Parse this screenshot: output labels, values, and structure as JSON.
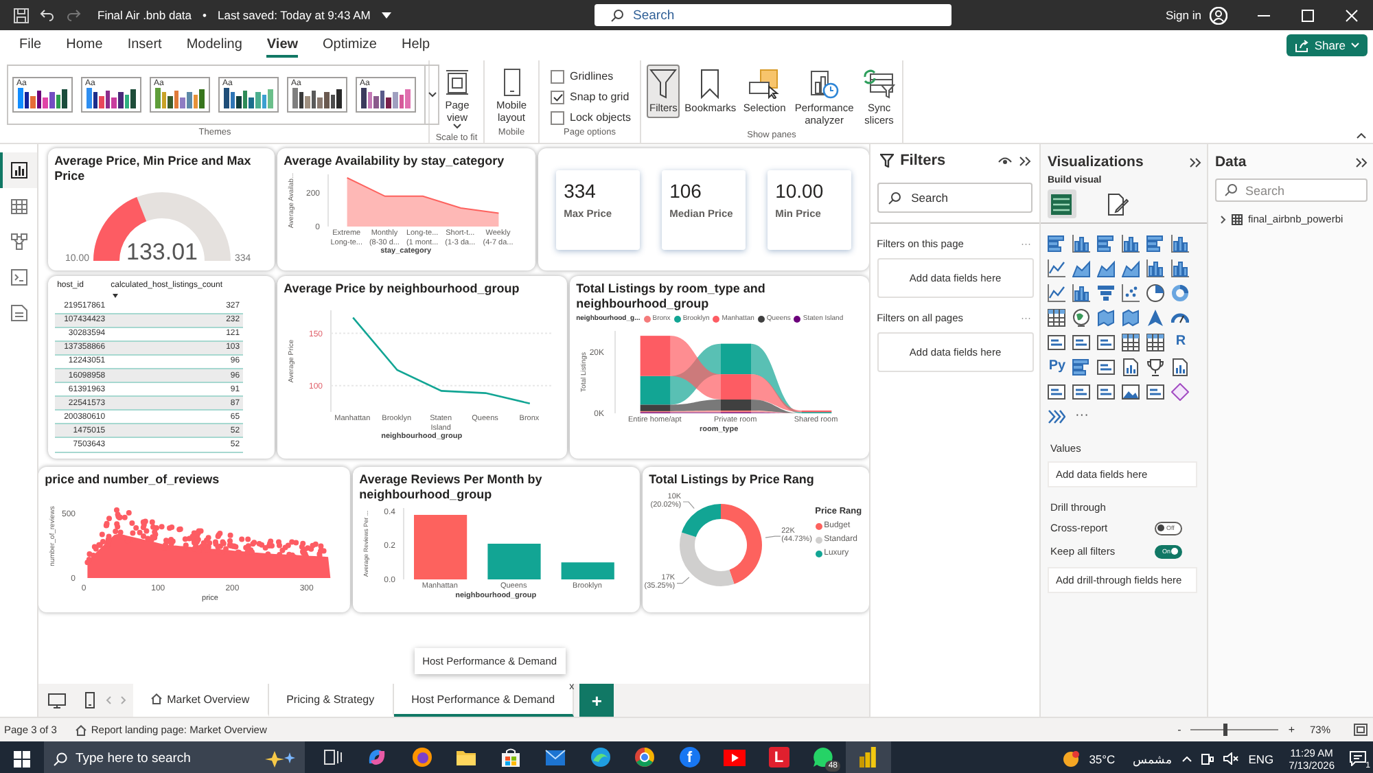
{
  "title_bar": {
    "title": "Final Air .bnb data",
    "separator": "•",
    "saved": "Last saved: Today at 9:43 AM",
    "search": {
      "placeholder": "Search"
    },
    "sign_in": "Sign in"
  },
  "menu": [
    {
      "label": "File",
      "selected": false
    },
    {
      "label": "Home",
      "selected": false
    },
    {
      "label": "Insert",
      "selected": false
    },
    {
      "label": "Modeling",
      "selected": false
    },
    {
      "label": "View",
      "selected": true
    },
    {
      "label": "Optimize",
      "selected": false
    },
    {
      "label": "Help",
      "selected": false
    }
  ],
  "share": {
    "label": "Share"
  },
  "ribbon": {
    "themes": {
      "group": "Themes",
      "items": [
        {
          "label": "Aa"
        },
        {
          "label": "Aa"
        },
        {
          "label": "Aa"
        },
        {
          "label": "Aa"
        },
        {
          "label": "Aa"
        },
        {
          "label": "Aa"
        }
      ]
    },
    "page_view": {
      "label": "Page view",
      "group": "Scale to fit"
    },
    "mobile": {
      "label": "Mobile layout",
      "group": "Mobile"
    },
    "page_options": {
      "group": "Page options",
      "items": [
        {
          "label": "Gridlines",
          "checked": false
        },
        {
          "label": "Snap to grid",
          "checked": true
        },
        {
          "label": "Lock objects",
          "checked": false
        }
      ]
    },
    "show_panes": {
      "group": "Show panes",
      "items": [
        {
          "kind": "filter",
          "label": "Filters",
          "selected": true
        },
        {
          "kind": "bookmark",
          "label": "Bookmarks",
          "selected": false
        },
        {
          "kind": "selection",
          "label": "Selection",
          "selected": false
        },
        {
          "kind": "performance",
          "label": "Performance analyzer",
          "selected": false
        },
        {
          "kind": "sync",
          "label": "Sync slicers",
          "selected": false
        }
      ]
    }
  },
  "views": [
    {
      "kind": "report",
      "selected": true
    },
    {
      "kind": "table",
      "selected": false
    },
    {
      "kind": "model",
      "selected": false
    },
    {
      "kind": "query",
      "selected": false
    },
    {
      "kind": "script",
      "selected": false
    }
  ],
  "report": {
    "gauge": {
      "title": "Average Price, Min Price and Max Price",
      "value": "133.01",
      "min": "10.00",
      "max": "334",
      "level": 0.38
    },
    "availability": {
      "title": "Average Availability by stay_category",
      "chart_data": {
        "type": "area",
        "xlabel": "stay_category",
        "ylabel": "Average Availab...",
        "categories": [
          "Extreme Long-te...",
          "Monthly (8-30 d...",
          "Long-te... (1 mont...",
          "Short-t... (1-3 da...",
          "Weekly (4-7 da..."
        ],
        "ylim": [
          0,
          310
        ],
        "yticks": [
          {
            "value": 0,
            "label": "0"
          },
          {
            "value": 200,
            "label": "200"
          }
        ],
        "series": [
          {
            "color": "#fd625e",
            "values": [
              290,
              180,
              180,
              110,
              80
            ]
          }
        ]
      }
    },
    "cards": [
      {
        "value": "334",
        "label": "Max Price"
      },
      {
        "value": "106",
        "label": "Median Price"
      },
      {
        "value": "10.00",
        "label": "Min Price"
      }
    ],
    "hosts": {
      "columns": [
        "host_id",
        "calculated_host_listings_count"
      ],
      "rows": [
        [
          "219517861",
          "327"
        ],
        [
          "107434423",
          "232"
        ],
        [
          "30283594",
          "121"
        ],
        [
          "137358866",
          "103"
        ],
        [
          "12243051",
          "96"
        ],
        [
          "16098958",
          "96"
        ],
        [
          "61391963",
          "91"
        ],
        [
          "22541573",
          "87"
        ],
        [
          "200380610",
          "65"
        ],
        [
          "1475015",
          "52"
        ],
        [
          "7503643",
          "52"
        ]
      ]
    },
    "price_line": {
      "title": "Average Price by neighbourhood_group",
      "chart_data": {
        "type": "line",
        "xlabel": "neighbourhood_group",
        "ylabel": "Average Price",
        "categories": [
          "Manhattan",
          "Brooklyn",
          "Staten Island",
          "Queens",
          "Bronx"
        ],
        "ylim": [
          75,
          172
        ],
        "yticks": [
          {
            "value": 100,
            "label": "100"
          },
          {
            "value": 150,
            "label": "150"
          }
        ],
        "series": [
          {
            "color": "#12a594",
            "values": [
              165,
              115,
              95,
              93,
              83
            ]
          }
        ]
      }
    },
    "listings_ribbon": {
      "title": "Total Listings by room_type and neighbourhood_group",
      "legend_title": "neighbourhood_g...",
      "chart_data": {
        "type": "bar",
        "stacked": true,
        "xlabel": "room_type",
        "ylabel": "Total Listings",
        "categories": [
          "Entire home/apt",
          "Private room",
          "Shared room"
        ],
        "ylim": [
          0,
          27000
        ],
        "yticks": [
          {
            "value": 0,
            "label": "0K"
          },
          {
            "value": 20000,
            "label": "20K"
          }
        ],
        "series": [
          {
            "name": "Bronx",
            "color": "#f47b7b",
            "values": [
              400,
              600,
              0
            ]
          },
          {
            "name": "Brooklyn",
            "color": "#12a594",
            "values": [
              9400,
              10000,
              400
            ]
          },
          {
            "name": "Manhattan",
            "color": "#fd5c63",
            "values": [
              13200,
              8300,
              500
            ]
          },
          {
            "name": "Queens",
            "color": "#404040",
            "values": [
              2100,
              3600,
              0
            ]
          },
          {
            "name": "Staten Island",
            "color": "#6b007b",
            "values": [
              300,
              300,
              0
            ]
          }
        ]
      }
    },
    "scatter": {
      "title": "price and number_of_reviews",
      "xlabel": "price",
      "ylabel": "number_of_reviews",
      "xticks": [
        "0",
        "100",
        "200",
        "300"
      ],
      "yticks": [
        "500",
        "0"
      ]
    },
    "reviews_bar": {
      "title": "Average Reviews Per Month by neighbourhood_group",
      "chart_data": {
        "type": "bar",
        "xlabel": "neighbourhood_group",
        "ylabel": "Average Reviews Per ...",
        "categories": [
          "Manhattan",
          "Queens",
          "Brooklyn"
        ],
        "ylim": [
          0,
          0.42
        ],
        "yticks": [
          {
            "value": 0,
            "label": "0.0"
          },
          {
            "value": 0.2,
            "label": "0.2"
          },
          {
            "value": 0.4,
            "label": "0.4"
          }
        ],
        "series": [
          {
            "colors": [
              "#fd625e",
              "#12a594",
              "#12a594"
            ],
            "values": [
              0.38,
              0.21,
              0.1
            ]
          }
        ]
      }
    },
    "price_range": {
      "title": "Total Listings by Price Rang",
      "legend_title": "Price Rang",
      "chart_data": {
        "type": "donut",
        "categories": [
          "Budget",
          "Standard",
          "Luxury"
        ],
        "values": [
          44.73,
          35.25,
          20.02
        ],
        "colors": [
          "#fd625e",
          "#d0cfce",
          "#12a594"
        ],
        "value_labels": [
          "22K (44.73%)",
          "17K (35.25%)",
          "10K (20.02%)"
        ]
      }
    }
  },
  "filters_pane": {
    "title": "Filters",
    "search": {
      "placeholder": "Search"
    },
    "sections": [
      {
        "title": "Filters on this page",
        "more": "···",
        "drop": "Add data fields here"
      },
      {
        "title": "Filters on all pages",
        "more": "···",
        "drop": "Add data fields here"
      }
    ]
  },
  "visualizations_pane": {
    "title": "Visualizations",
    "build_label": "Build visual",
    "modes": [
      {
        "kind": "build",
        "selected": true
      },
      {
        "kind": "format",
        "selected": false
      }
    ],
    "types": [
      {
        "kind": "hbar"
      },
      {
        "kind": "vbar"
      },
      {
        "kind": "hbar"
      },
      {
        "kind": "vbar"
      },
      {
        "kind": "hbar"
      },
      {
        "kind": "vbar"
      },
      {
        "kind": "line"
      },
      {
        "kind": "area"
      },
      {
        "kind": "area"
      },
      {
        "kind": "area"
      },
      {
        "kind": "vbar"
      },
      {
        "kind": "vbar"
      },
      {
        "kind": "line"
      },
      {
        "kind": "vbar"
      },
      {
        "kind": "funnel"
      },
      {
        "kind": "scatter"
      },
      {
        "kind": "pie"
      },
      {
        "kind": "donut"
      },
      {
        "kind": "table"
      },
      {
        "kind": "globe"
      },
      {
        "kind": "map"
      },
      {
        "kind": "map"
      },
      {
        "kind": "arrow"
      },
      {
        "kind": "gauge"
      },
      {
        "kind": "card"
      },
      {
        "kind": "card"
      },
      {
        "kind": "card"
      },
      {
        "kind": "table"
      },
      {
        "kind": "table"
      },
      {
        "kind": "text",
        "label": "R"
      },
      {
        "kind": "text",
        "label": "Py"
      },
      {
        "kind": "hbar"
      },
      {
        "kind": "card"
      },
      {
        "kind": "doc"
      },
      {
        "kind": "trophy"
      },
      {
        "kind": "doc"
      },
      {
        "kind": "card"
      },
      {
        "kind": "card"
      },
      {
        "kind": "card"
      },
      {
        "kind": "image"
      },
      {
        "kind": "card"
      },
      {
        "kind": "diamond"
      },
      {
        "kind": "chevrons"
      },
      {
        "kind": "more",
        "label": "···"
      }
    ],
    "values_label": "Values",
    "values_drop": "Add data fields here",
    "drill_label": "Drill through",
    "toggles": [
      {
        "label": "Cross-report",
        "on": false,
        "state": "Off"
      },
      {
        "label": "Keep all filters",
        "on": true,
        "state": "On"
      }
    ],
    "drill_drop": "Add drill-through fields here"
  },
  "data_pane": {
    "title": "Data",
    "search": {
      "placeholder": "Search"
    },
    "tables": [
      {
        "name": "final_airbnb_powerbi",
        "expanded": false
      }
    ]
  },
  "page_tabs": {
    "tabs": [
      {
        "label": "Market Overview",
        "home": true,
        "selected": false
      },
      {
        "label": "Pricing & Strategy",
        "home": false,
        "selected": false
      },
      {
        "label": "Host Performance & Demand",
        "home": false,
        "selected": true,
        "close": "x"
      }
    ],
    "add": "+",
    "tooltip": "Host Performance & Demand"
  },
  "status_bar": {
    "page": "Page 3 of 3",
    "landing": "Report landing page: Market Overview",
    "zoom": {
      "minus": "-",
      "plus": "+",
      "level": 0.4,
      "value": "73%"
    }
  },
  "taskbar": {
    "search": {
      "placeholder": "Type here to search"
    },
    "apps": [
      {
        "kind": "taskview",
        "selected": false
      },
      {
        "kind": "swirl",
        "selected": false
      },
      {
        "kind": "fox",
        "selected": false
      },
      {
        "kind": "folder",
        "selected": false
      },
      {
        "kind": "bag",
        "selected": false
      },
      {
        "kind": "mail",
        "selected": false
      },
      {
        "kind": "wave",
        "selected": false
      },
      {
        "kind": "ball",
        "selected": false
      },
      {
        "kind": "round_letter",
        "label": "f",
        "selected": false
      },
      {
        "kind": "play",
        "selected": false
      },
      {
        "kind": "square_letter",
        "label": "L",
        "selected": false
      },
      {
        "kind": "chat",
        "badge": "48",
        "selected": false
      },
      {
        "kind": "bars",
        "selected": true
      }
    ],
    "weather": {
      "temperature": "35°C",
      "condition": "مشمس"
    },
    "language": "ENG",
    "time": "11:29 AM",
    "date": "7/13/2026",
    "notifications": "1"
  }
}
